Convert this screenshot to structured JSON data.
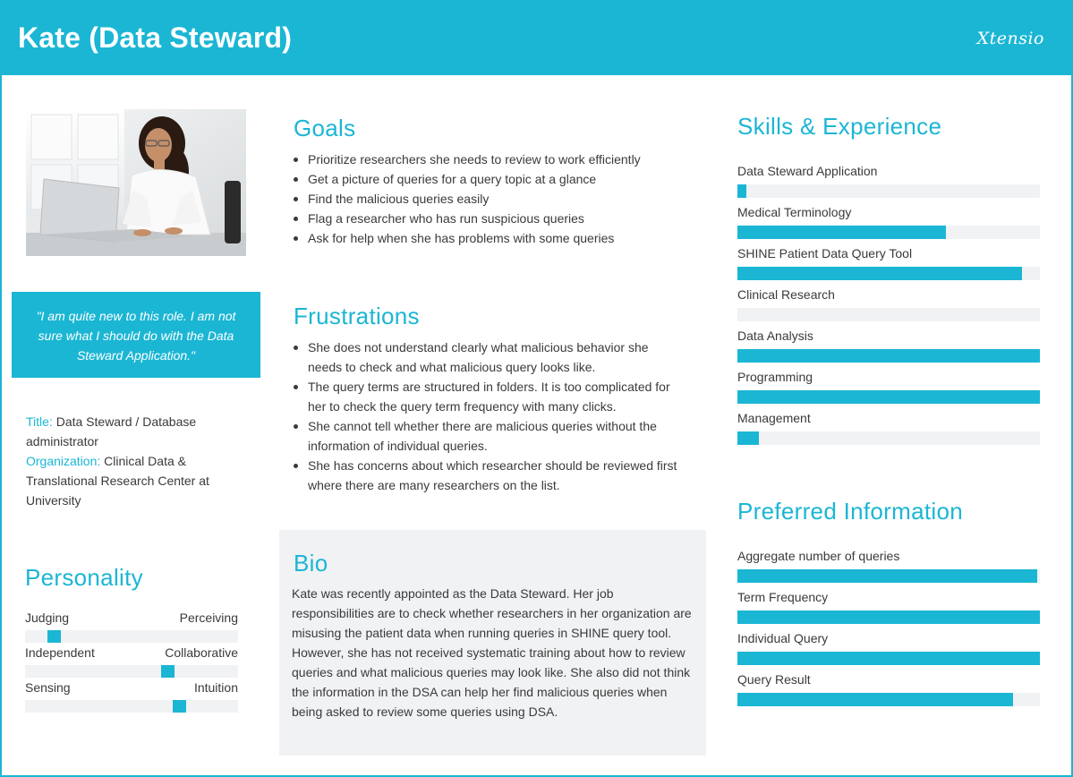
{
  "header": {
    "title": "Kate (Data Steward)",
    "logo": "Xtensio"
  },
  "quote": "\"I am quite new to this role. I am not sure what I should do with the Data Steward Application.\"",
  "meta": {
    "title_key": "Title:",
    "title_value": " Data Steward / Database administrator",
    "org_key": "Organization:",
    "org_value": " Clinical Data & Translational Research Center at University"
  },
  "personality": {
    "heading": "Personality",
    "traits": [
      {
        "left": "Judging",
        "right": "Perceiving",
        "value": 0.11
      },
      {
        "left": "Independent",
        "right": "Collaborative",
        "value": 0.68
      },
      {
        "left": "Sensing",
        "right": "Intuition",
        "value": 0.74
      }
    ]
  },
  "goals": {
    "heading": "Goals",
    "items": [
      "Prioritize researchers she needs to review to work efficiently",
      "Get a picture of queries for a query topic at a glance",
      "Find the malicious queries easily",
      "Flag a researcher who has run suspicious queries",
      "Ask for help when she has problems with some queries"
    ]
  },
  "frustrations": {
    "heading": "Frustrations",
    "items": [
      "She does not understand clearly what malicious behavior she needs to check and what malicious query looks like.",
      "The query terms are structured in folders. It is too complicated for her to check the query term frequency with many clicks.",
      "She cannot tell whether there are malicious queries without the information of individual queries.",
      "She has concerns about which researcher should be reviewed first where there are many researchers on the list."
    ]
  },
  "bio": {
    "heading": "Bio",
    "text": "Kate was recently appointed as the Data Steward. Her job responsibilities are to check whether researchers in her organization are misusing the patient data when running queries in SHINE query tool. However, she has not received systematic training about how to review queries and what malicious queries may look like. She also did not think the information in the DSA can help her find malicious queries when being asked to review some queries using DSA."
  },
  "skills": {
    "heading": "Skills & Experience",
    "items": [
      {
        "label": "Data Steward Application",
        "value": 0.03
      },
      {
        "label": "Medical Terminology",
        "value": 0.69
      },
      {
        "label": "SHINE Patient Data Query Tool",
        "value": 0.94
      },
      {
        "label": "Clinical Research",
        "value": 0.0
      },
      {
        "label": "Data Analysis",
        "value": 1.0
      },
      {
        "label": "Programming",
        "value": 1.0
      },
      {
        "label": "Management",
        "value": 0.07
      }
    ]
  },
  "preferred": {
    "heading": "Preferred Information",
    "items": [
      {
        "label": "Aggregate number of queries",
        "value": 0.99
      },
      {
        "label": "Term Frequency",
        "value": 1.0
      },
      {
        "label": "Individual Query",
        "value": 1.0
      },
      {
        "label": "Query Result",
        "value": 0.91
      }
    ]
  },
  "colors": {
    "accent": "#1bb6d4",
    "track": "#f1f2f4",
    "text": "#3a3a3a"
  }
}
